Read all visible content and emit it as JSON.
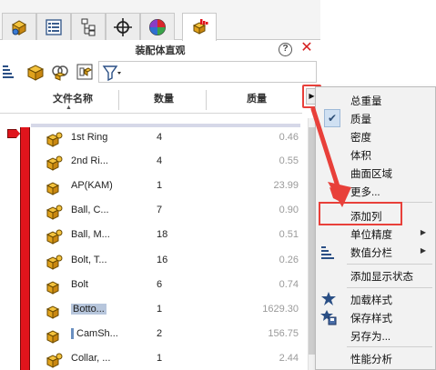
{
  "panel": {
    "title": "装配体直观",
    "help_label": "?",
    "close_label": "✕"
  },
  "tabs": [
    {
      "icon": "assembly-feature-icon",
      "active": false
    },
    {
      "icon": "property-list-icon",
      "active": false
    },
    {
      "icon": "configuration-icon",
      "active": false
    },
    {
      "icon": "crosshair-icon",
      "active": false
    },
    {
      "icon": "appearance-pie-icon",
      "active": false
    },
    {
      "icon": "assembly-visualization-icon",
      "active": true
    }
  ],
  "columns": {
    "name": "文件名称",
    "quantity": "数量",
    "mass": "质量",
    "menu_button": "▶",
    "sort_indicator": "▲"
  },
  "rows": [
    {
      "name": "1st Ring",
      "quantity": "4",
      "mass": "0.46",
      "style": "normal"
    },
    {
      "name": "2nd Ri...",
      "quantity": "4",
      "mass": "0.55",
      "style": "normal"
    },
    {
      "name": "AP(KAM)",
      "quantity": "1",
      "mass": "23.99",
      "style": "normal"
    },
    {
      "name": "Ball, C...",
      "quantity": "7",
      "mass": "0.90",
      "style": "normal"
    },
    {
      "name": "Ball, M...",
      "quantity": "18",
      "mass": "0.51",
      "style": "normal"
    },
    {
      "name": "Bolt, T...",
      "quantity": "16",
      "mass": "0.26",
      "style": "normal"
    },
    {
      "name": "Bolt",
      "quantity": "6",
      "mass": "0.74",
      "style": "normal"
    },
    {
      "name": "Botto...",
      "quantity": "1",
      "mass": "1629.30",
      "style": "selected"
    },
    {
      "name": "CamSh...",
      "quantity": "2",
      "mass": "156.75",
      "style": "marked"
    },
    {
      "name": "Collar, ...",
      "quantity": "1",
      "mass": "2.44",
      "style": "normal"
    }
  ],
  "menu": {
    "items": [
      {
        "label": "总重量",
        "checked": false,
        "submenu": false
      },
      {
        "label": "质量",
        "checked": true,
        "submenu": false
      },
      {
        "label": "密度",
        "checked": false,
        "submenu": false
      },
      {
        "label": "体积",
        "checked": false,
        "submenu": false
      },
      {
        "label": "曲面区域",
        "checked": false,
        "submenu": false
      },
      {
        "label": "更多...",
        "checked": false,
        "submenu": false
      },
      {
        "label": "添加列",
        "checked": false,
        "submenu": false
      },
      {
        "label": "单位精度",
        "checked": false,
        "submenu": true
      },
      {
        "label": "数值分栏",
        "checked": false,
        "submenu": true
      },
      {
        "label": "添加显示状态",
        "checked": false,
        "submenu": false
      },
      {
        "label": "加载样式",
        "checked": false,
        "submenu": false
      },
      {
        "label": "保存样式",
        "checked": false,
        "submenu": false
      },
      {
        "label": "另存为...",
        "checked": false,
        "submenu": false
      },
      {
        "label": "性能分析",
        "checked": false,
        "submenu": false
      }
    ],
    "check_glyph": "✔",
    "submenu_glyph": "▶"
  },
  "colors": {
    "accent_red": "#e8403a",
    "bar_red": "#e0141c",
    "selection_blue": "#b7c6dc"
  }
}
